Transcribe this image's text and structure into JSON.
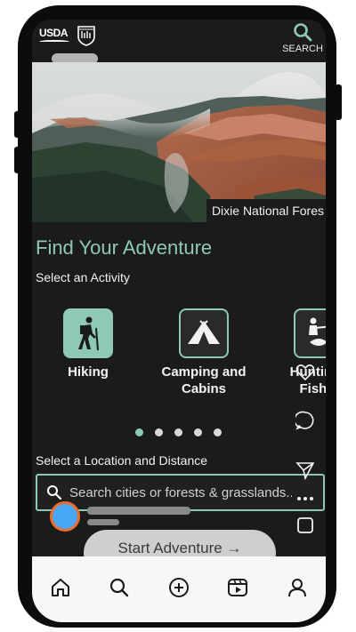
{
  "header": {
    "usda_label": "USDA",
    "search_label": "SEARCH"
  },
  "hero": {
    "caption": "Dixie National Fores"
  },
  "main": {
    "title": "Find Your Adventure",
    "activity_section_label": "Select an Activity",
    "activities": [
      {
        "label_line1": "Hiking",
        "label_line2": "",
        "icon": "hiker-icon"
      },
      {
        "label_line1": "Camping and",
        "label_line2": "Cabins",
        "icon": "tent-icon"
      },
      {
        "label_line1": "Hunting",
        "label_line2": "Fishi",
        "icon": "hunter-fish-icon"
      }
    ],
    "carousel": {
      "page_count": 5,
      "active_index": 0
    },
    "location_section_label": "Select a Location and Distance",
    "search_placeholder": "Search cities or forests & grasslands...",
    "start_button_label": "Start Adventure →"
  },
  "overlay_icons": [
    "heart-icon",
    "comment-icon",
    "share-icon",
    "more-icon",
    "save-icon"
  ],
  "bottom_nav": [
    "home-icon",
    "search-icon",
    "add-icon",
    "reels-icon",
    "profile-icon"
  ],
  "colors": {
    "accent": "#8ec9b5",
    "background": "#1b1b1b",
    "avatar_fill": "#48a8f5",
    "avatar_ring": "#ef6d2b"
  }
}
